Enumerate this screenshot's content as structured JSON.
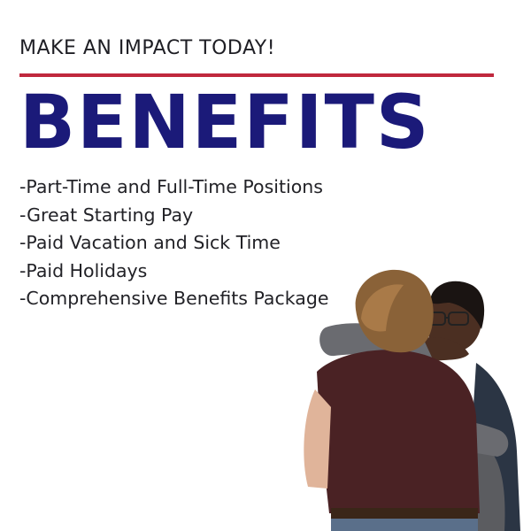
{
  "header": {
    "tagline": "MAKE AN IMPACT TODAY!",
    "title": "BENEFITS"
  },
  "benefits": [
    "-Part-Time and Full-Time Positions",
    "-Great Starting Pay",
    "-Paid Vacation and Sick Time",
    "-Paid Holidays",
    "-Comprehensive Benefits Package"
  ],
  "colors": {
    "accent_rule": "#c0283d",
    "title": "#1b1a79",
    "text": "#222227"
  },
  "image": {
    "subject": "two-people-hugging-photo"
  }
}
